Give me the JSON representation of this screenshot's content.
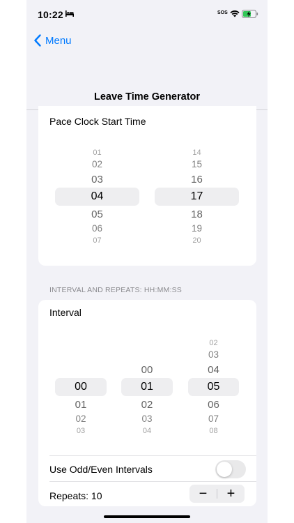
{
  "status_bar": {
    "time": "10:22",
    "sos": "SOS"
  },
  "nav": {
    "back_label": "Menu",
    "title": "Leave Time Generator"
  },
  "pace_clock": {
    "title": "Pace Clock Start Time",
    "hours": [
      "01",
      "02",
      "03",
      "04",
      "05",
      "06",
      "07"
    ],
    "minutes": [
      "14",
      "15",
      "16",
      "17",
      "18",
      "19",
      "20"
    ],
    "selected_hour": "04",
    "selected_minute": "17"
  },
  "interval_section": {
    "header": "INTERVAL AND REPEATS: HH:MM:SS",
    "title": "Interval",
    "hours": [
      "00",
      "01",
      "02",
      "03"
    ],
    "minutes": [
      "00",
      "01",
      "02",
      "03",
      "04"
    ],
    "seconds": [
      "02",
      "03",
      "04",
      "05",
      "06",
      "07",
      "08"
    ],
    "selected_hour": "00",
    "selected_minute": "01",
    "selected_second": "05"
  },
  "odd_even": {
    "label": "Use Odd/Even Intervals",
    "enabled": false
  },
  "repeats": {
    "label": "Repeats: 10",
    "minus": "−",
    "plus": "+"
  },
  "colors": {
    "accent": "#007aff",
    "background": "#f2f2f7",
    "card": "#ffffff",
    "secondary_text": "#8a8a8e"
  }
}
